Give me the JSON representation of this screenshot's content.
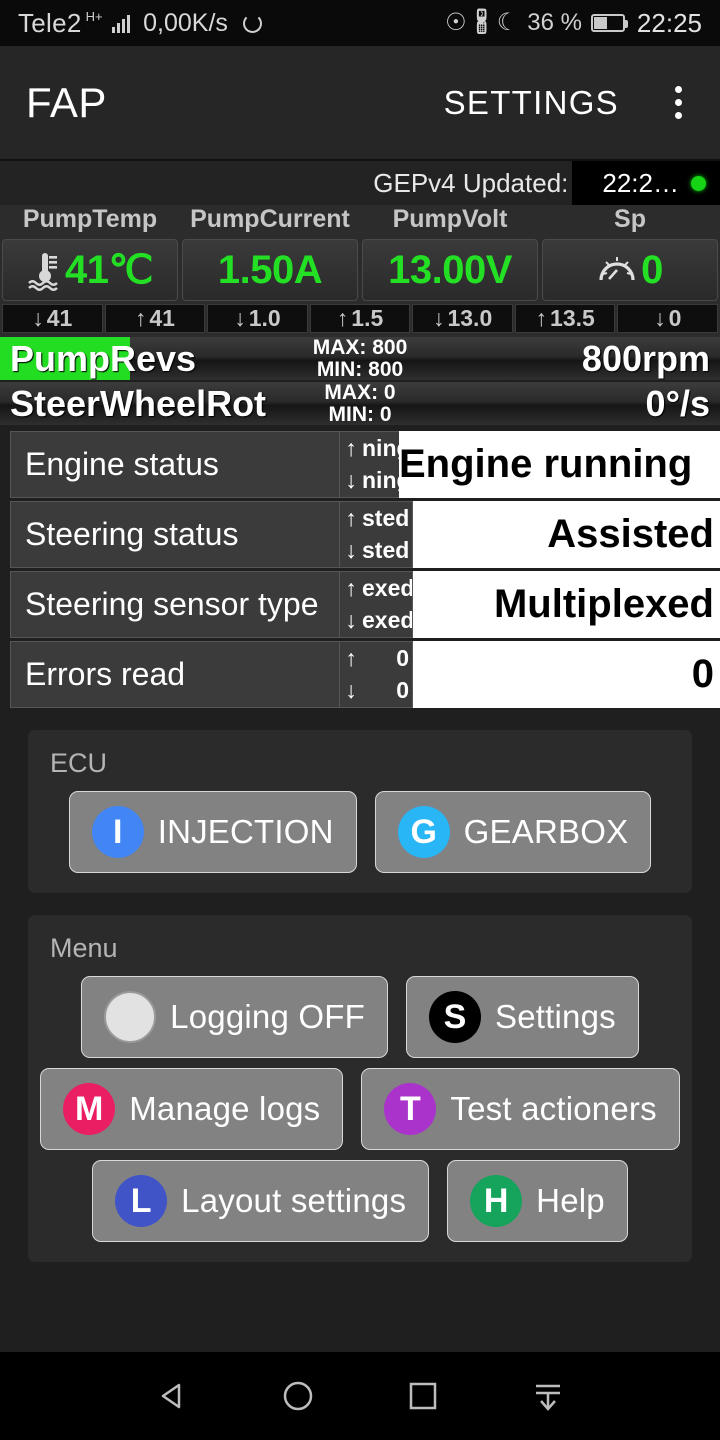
{
  "statusbar": {
    "carrier": "Tele2",
    "network_type": "H+",
    "net_speed": "0,00K/s",
    "battery_percent": "36 %",
    "clock": "22:25",
    "icons": [
      "eye-care-icon",
      "bluetooth-icon",
      "do-not-disturb-moon-icon",
      "battery-icon"
    ]
  },
  "appbar": {
    "title": "FAP",
    "settings_label": "SETTINGS",
    "overflow_label": "overflow-menu"
  },
  "updated": {
    "label": "GEPv4 Updated:",
    "value": "22:2…",
    "status_color": "#16d316"
  },
  "gauges": [
    {
      "name": "PumpTemp",
      "value": "41℃",
      "icon": "coolant-temp-icon",
      "min": "41",
      "max": "41",
      "color": "#24e024"
    },
    {
      "name": "PumpCurrent",
      "value": "1.50A",
      "icon": "",
      "min": "1.0",
      "max": "1.5",
      "color": "#24e024"
    },
    {
      "name": "PumpVolt",
      "value": "13.00V",
      "icon": "",
      "min": "13.0",
      "max": "13.5",
      "color": "#24e024"
    },
    {
      "name": "Sp",
      "value": "0",
      "icon": "speedometer-icon",
      "min": "0",
      "max": "",
      "color": "#24e024"
    }
  ],
  "bars": [
    {
      "name": "PumpRevs",
      "max": "MAX: 800",
      "min": "MIN: 800",
      "value": "800rpm",
      "fill_percent": 18,
      "fill_color": "#22dd22"
    },
    {
      "name": "SteerWheelRot",
      "max": "MAX: 0",
      "min": "MIN: 0",
      "value": "0°/s",
      "fill_percent": 0,
      "fill_color": "#22dd22"
    }
  ],
  "status_rows": [
    {
      "label": "Engine status",
      "max": "ning",
      "min": "ning",
      "value": "Engine running",
      "overflowing": true
    },
    {
      "label": "Steering status",
      "max": "sted",
      "min": "sted",
      "value": "Assisted",
      "overflowing": false
    },
    {
      "label": "Steering sensor type",
      "max": "exed",
      "min": "exed",
      "value": "Multiplexed",
      "overflowing": false
    },
    {
      "label": "Errors read",
      "max": "0",
      "min": "0",
      "value": "0",
      "overflowing": false
    }
  ],
  "ecu_panel": {
    "title": "ECU",
    "buttons": [
      {
        "label": "INJECTION",
        "badge": "I",
        "badge_color": "#4285f4"
      },
      {
        "label": "GEARBOX",
        "badge": "G",
        "badge_color": "#29b6f6"
      }
    ]
  },
  "menu_panel": {
    "title": "Menu",
    "buttons": [
      {
        "label": "Logging OFF",
        "badge": "",
        "badge_color": "#e2e2e2"
      },
      {
        "label": "Settings",
        "badge": "S",
        "badge_color": "#000000"
      },
      {
        "label": "Manage logs",
        "badge": "M",
        "badge_color": "#e91e63"
      },
      {
        "label": "Test actioners",
        "badge": "T",
        "badge_color": "#aa33cc"
      },
      {
        "label": "Layout settings",
        "badge": "L",
        "badge_color": "#4054c8"
      },
      {
        "label": "Help",
        "badge": "H",
        "badge_color": "#16a35c"
      }
    ]
  },
  "navbar": {
    "back": "back-icon",
    "home": "home-icon",
    "recents": "recents-icon",
    "hide": "hide-navbar-icon"
  }
}
